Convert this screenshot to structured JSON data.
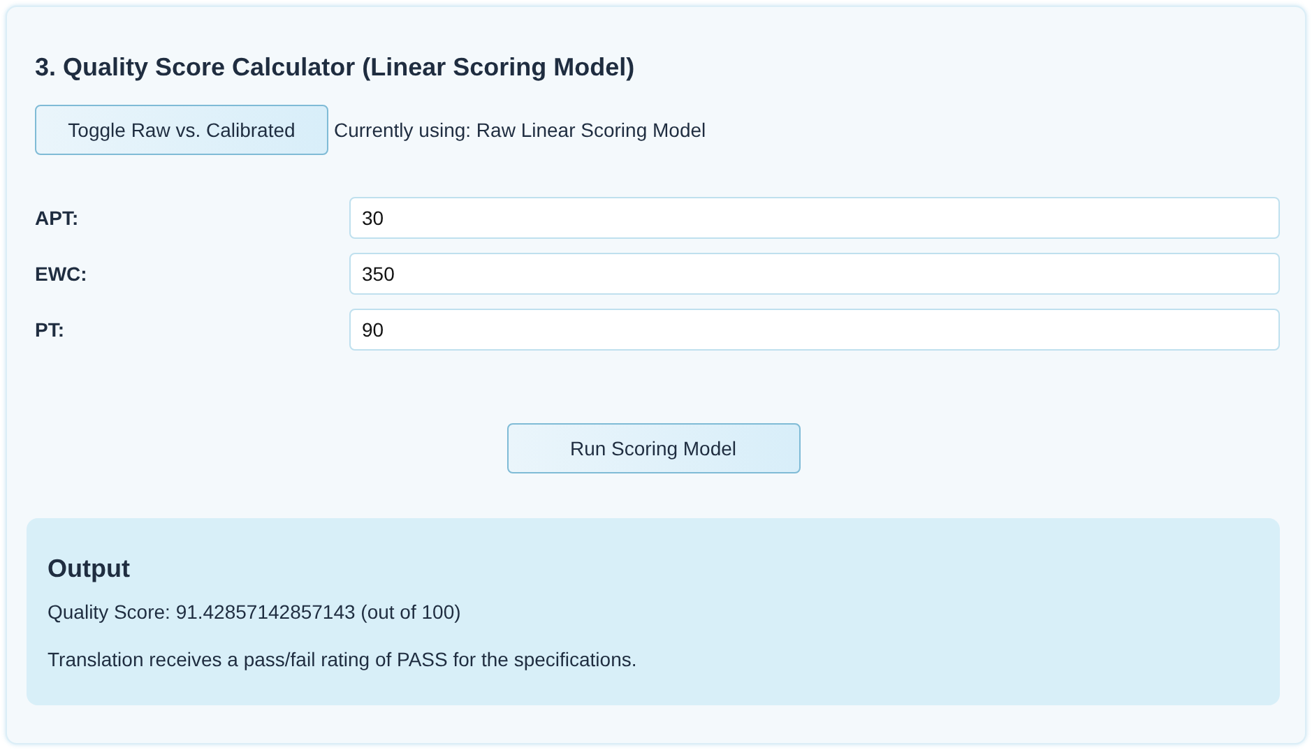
{
  "title": "3. Quality Score Calculator (Linear Scoring Model)",
  "toggle_button": "Toggle Raw vs. Calibrated",
  "mode_status": "Currently using: Raw Linear Scoring Model",
  "fields": [
    {
      "label": "APT:",
      "value": "30"
    },
    {
      "label": "EWC:",
      "value": "350"
    },
    {
      "label": "PT:",
      "value": "90"
    }
  ],
  "run_button": "Run Scoring Model",
  "output": {
    "heading": "Output",
    "lines": [
      "Quality Score: 91.42857142857143 (out of 100)",
      "Translation receives a pass/fail rating of PASS for the specifications."
    ]
  }
}
